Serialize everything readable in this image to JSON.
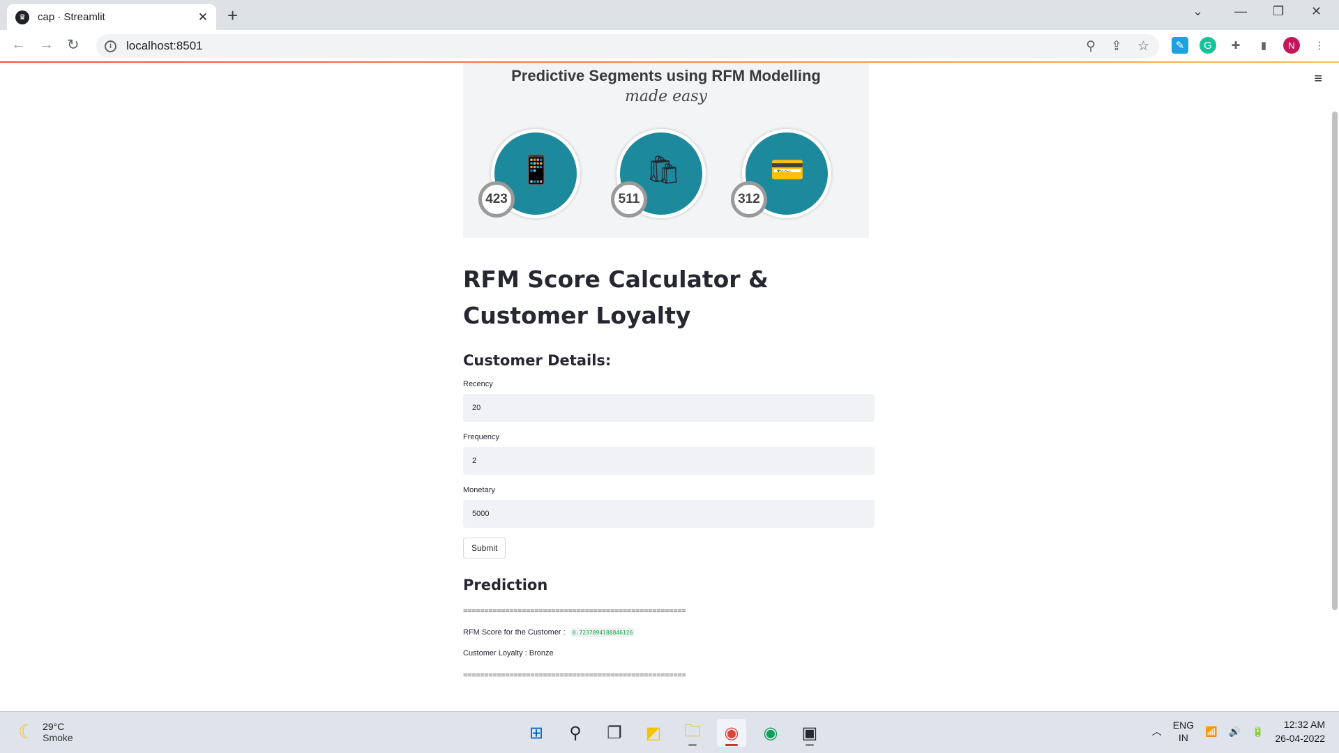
{
  "browser": {
    "tab_title": "cap · Streamlit",
    "url": "localhost:8501",
    "profile_initial": "N"
  },
  "banner": {
    "title": "Predictive Segments using RFM Modelling",
    "subtitle": "made easy",
    "badges": [
      "423",
      "511",
      "312"
    ]
  },
  "app": {
    "title": "RFM Score Calculator & Customer Loyalty",
    "section_header": "Customer Details:",
    "fields": [
      {
        "label": "Recency",
        "value": "20"
      },
      {
        "label": "Frequency",
        "value": "2"
      },
      {
        "label": "Monetary",
        "value": "5000"
      }
    ],
    "submit_label": "Submit",
    "prediction_header": "Prediction",
    "separator": "=====================================================",
    "rfm_label": "RFM Score for the Customer :",
    "rfm_value": "0.7237894188846126",
    "loyalty_text": "Customer Loyalty : Bronze"
  },
  "taskbar": {
    "temperature": "29°C",
    "condition": "Smoke",
    "lang_top": "ENG",
    "lang_bottom": "IN",
    "time": "12:32 AM",
    "date": "26-04-2022"
  },
  "colors": {
    "accent": "#ff4b4b",
    "code_green": "#09ab3b",
    "input_bg": "#f0f2f6",
    "banner_teal": "#1c8a9c"
  }
}
